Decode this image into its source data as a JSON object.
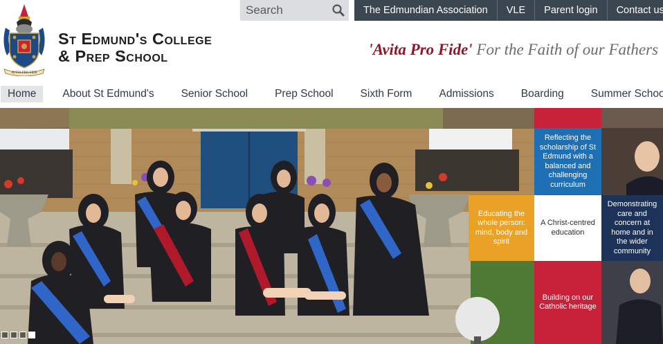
{
  "header": {
    "search": {
      "placeholder": "Search",
      "icon": "search-icon"
    },
    "utility_nav": [
      "The Edmundian Association",
      "VLE",
      "Parent login",
      "Contact us"
    ],
    "school_name": [
      "St Edmund's College",
      "& Prep School"
    ],
    "motto_latin": "'Avita Pro Fide'",
    "motto_english": "For the Faith of our Fathers",
    "crest_text": "AVITA PRO FIDE"
  },
  "main_nav": {
    "items": [
      "Home",
      "About St Edmund's",
      "Senior School",
      "Prep School",
      "Sixth Form",
      "Admissions",
      "Boarding",
      "Summer School"
    ],
    "active": "Home"
  },
  "hero": {
    "tiles": {
      "blue": "Reflecting the scholarship of St Edmund with a balanced and challenging curriculum",
      "orange": "Educating the whole person: mind, body and spirit",
      "white": "A Christ-centred education",
      "navy": "Demonstrating care and concern at home and in the wider community",
      "red": "Building on our Catholic heritage"
    },
    "slider_count": 4,
    "slider_active": 4
  },
  "colors": {
    "utility_bar": "#3b4750",
    "accent_red": "#c8223a",
    "accent_blue": "#1e6fb3",
    "accent_orange": "#e9a226",
    "accent_navy": "#1c3259"
  }
}
